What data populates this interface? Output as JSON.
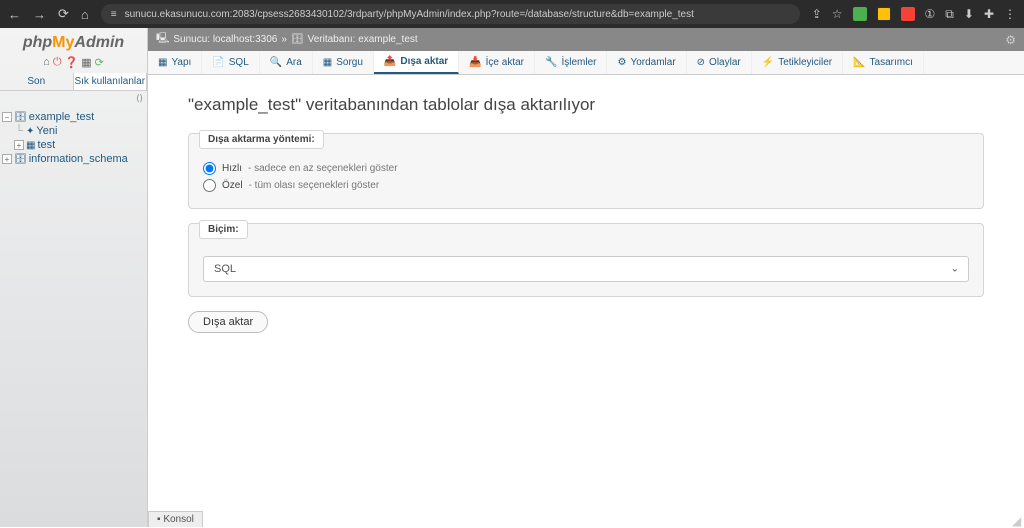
{
  "browser": {
    "url": "sunucu.ekasunucu.com:2083/cpsess2683430102/3rdparty/phpMyAdmin/index.php?route=/database/structure&db=example_test",
    "badge": "①"
  },
  "logo": {
    "php": "php",
    "my": "My",
    "admin": "Admin"
  },
  "sidebar": {
    "tabs": {
      "recent": "Son",
      "fav": "Sık kullanılanlar"
    },
    "tree": [
      {
        "expand": "−",
        "label": "example_test",
        "children": [
          {
            "label": "Yeni"
          },
          {
            "label": "test"
          }
        ]
      },
      {
        "expand": "+",
        "label": "information_schema"
      }
    ]
  },
  "breadcrumb": {
    "server_prefix": "Sunucu:",
    "server": "localhost:3306",
    "db_prefix": "Veritabanı:",
    "db": "example_test"
  },
  "tabs": {
    "structure": "Yapı",
    "sql": "SQL",
    "search": "Ara",
    "query": "Sorgu",
    "export": "Dışa aktar",
    "import": "İçe aktar",
    "operations": "İşlemler",
    "routines": "Yordamlar",
    "events": "Olaylar",
    "triggers": "Tetikleyiciler",
    "designer": "Tasarımcı"
  },
  "page": {
    "title": "\"example_test\" veritabanından tablolar dışa aktarılıyor",
    "method_legend": "Dışa aktarma yöntemi:",
    "quick_label": "Hızlı",
    "quick_sub": " - sadece en az seçenekleri göster",
    "custom_label": "Özel",
    "custom_sub": " - tüm olası seçenekleri göster",
    "format_legend": "Biçim:",
    "format_value": "SQL",
    "submit": "Dışa aktar"
  },
  "konsol": "Konsol"
}
